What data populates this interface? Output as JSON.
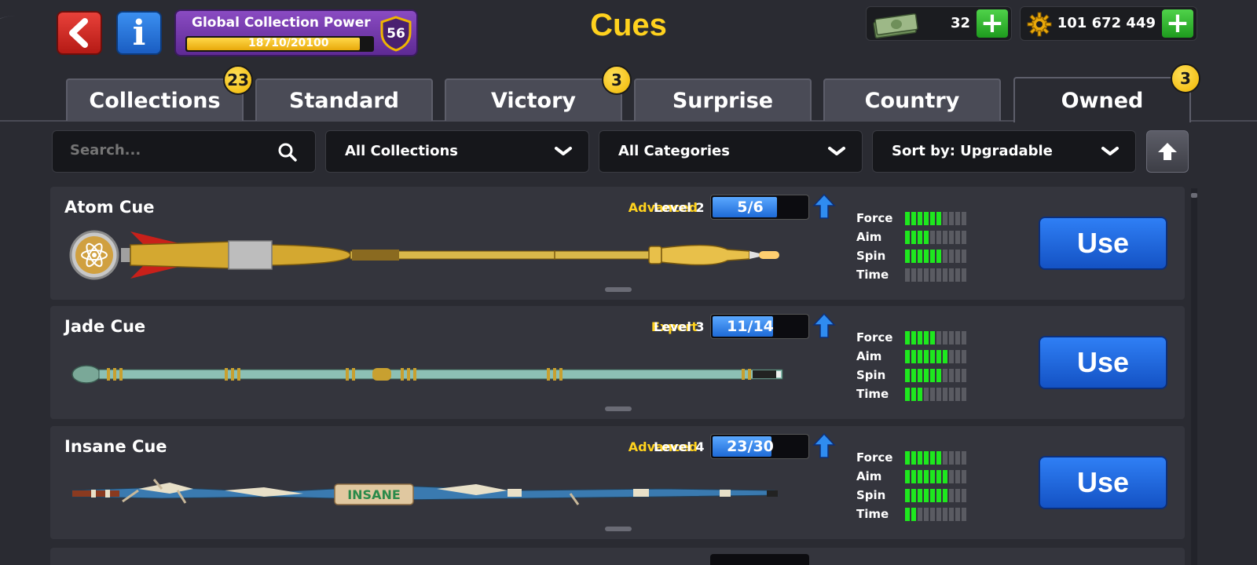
{
  "header": {
    "back_icon": "back-arrow-icon",
    "info_label": "i",
    "title": "Cues",
    "collection_power": {
      "label": "Global Collection Power",
      "current": 18710,
      "max": 20100,
      "text": "18710/20100",
      "level": "56"
    },
    "cash": {
      "amount": "32",
      "plus": "+"
    },
    "coins": {
      "amount": "101 672 449",
      "plus": "+"
    }
  },
  "tabs": [
    {
      "label": "Collections",
      "badge": "23"
    },
    {
      "label": "Standard",
      "badge": ""
    },
    {
      "label": "Victory",
      "badge": "3"
    },
    {
      "label": "Surprise",
      "badge": ""
    },
    {
      "label": "Country",
      "badge": ""
    },
    {
      "label": "Owned",
      "badge": "3",
      "active": true
    }
  ],
  "filters": {
    "search_placeholder": "Search...",
    "collections": "All Collections",
    "categories": "All Categories",
    "sort": "Sort by: Upgradable"
  },
  "cues": [
    {
      "name": "Atom Cue",
      "rarity": "Advanced",
      "level": "Level 2",
      "progress": "5/6",
      "progress_value": 0.8333,
      "stats": {
        "Force": 6,
        "Aim": 4,
        "Spin": 6,
        "Time": 0
      },
      "use_label": "Use"
    },
    {
      "name": "Jade Cue",
      "rarity": "Expert",
      "level": "Level 3",
      "progress": "11/14",
      "progress_value": 0.7857,
      "stats": {
        "Force": 5,
        "Aim": 7,
        "Spin": 6,
        "Time": 3
      },
      "use_label": "Use"
    },
    {
      "name": "Insane Cue",
      "rarity": "Advanced",
      "level": "Level 4",
      "progress": "23/30",
      "progress_value": 0.7667,
      "stats": {
        "Force": 6,
        "Aim": 7,
        "Spin": 7,
        "Time": 2
      },
      "use_label": "Use"
    }
  ],
  "stat_labels": [
    "Force",
    "Aim",
    "Spin",
    "Time"
  ],
  "colors": {
    "accent_gold": "#ffd21e",
    "use_blue": "#1e6ad6",
    "stat_green": "#1ee81e",
    "purple": "#6e34a8"
  }
}
